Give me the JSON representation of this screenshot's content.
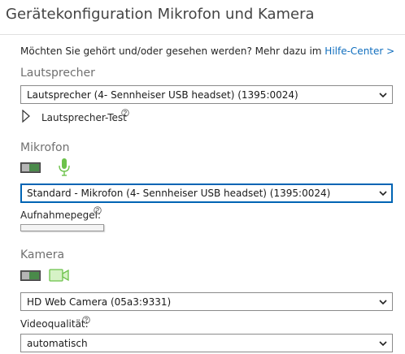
{
  "window": {
    "title": "Gerätekonfiguration Mikrofon und Kamera"
  },
  "intro": {
    "text": "Möchten Sie gehört und/oder gesehen werden? Mehr dazu im ",
    "link": "Hilfe-Center >"
  },
  "speaker": {
    "heading": "Lautsprecher",
    "selected": "Lautsprecher (4- Sennheiser USB headset) (1395:0024)",
    "test_label": "Lautsprecher-Test"
  },
  "microphone": {
    "heading": "Mikrofon",
    "selected": "Standard - Mikrofon (4- Sennheiser USB headset) (1395:0024)",
    "level_label": "Aufnahmepegel:",
    "level": 0
  },
  "camera": {
    "heading": "Kamera",
    "selected": "HD Web Camera (05a3:9331)",
    "quality_label": "Videoqualität:",
    "quality_selected": "automatisch"
  },
  "colors": {
    "accent": "#106ebe",
    "green_icon": "#6cc24a",
    "focus": "#0064b4"
  }
}
